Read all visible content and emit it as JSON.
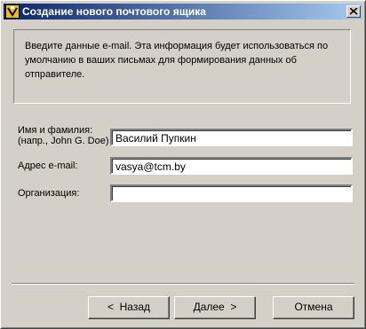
{
  "window": {
    "title": "Создание нового почтового ящика"
  },
  "info": {
    "text": "Введите данные e-mail. Эта информация будет использоваться по умолчанию в ваших письмах для формирования данных об отправителе."
  },
  "form": {
    "name_label_line1": "Имя и фамилия:",
    "name_label_line2": "(напр., John G. Doe)",
    "name_value": "Василий Пупкин",
    "email_label": "Адрес e-mail:",
    "email_value": "vasya@tcm.by",
    "org_label": "Организация:",
    "org_value": ""
  },
  "buttons": {
    "back_arrow": "<",
    "back_label": "Назад",
    "next_label": "Далее",
    "next_arrow": ">",
    "cancel_label": "Отмена"
  }
}
